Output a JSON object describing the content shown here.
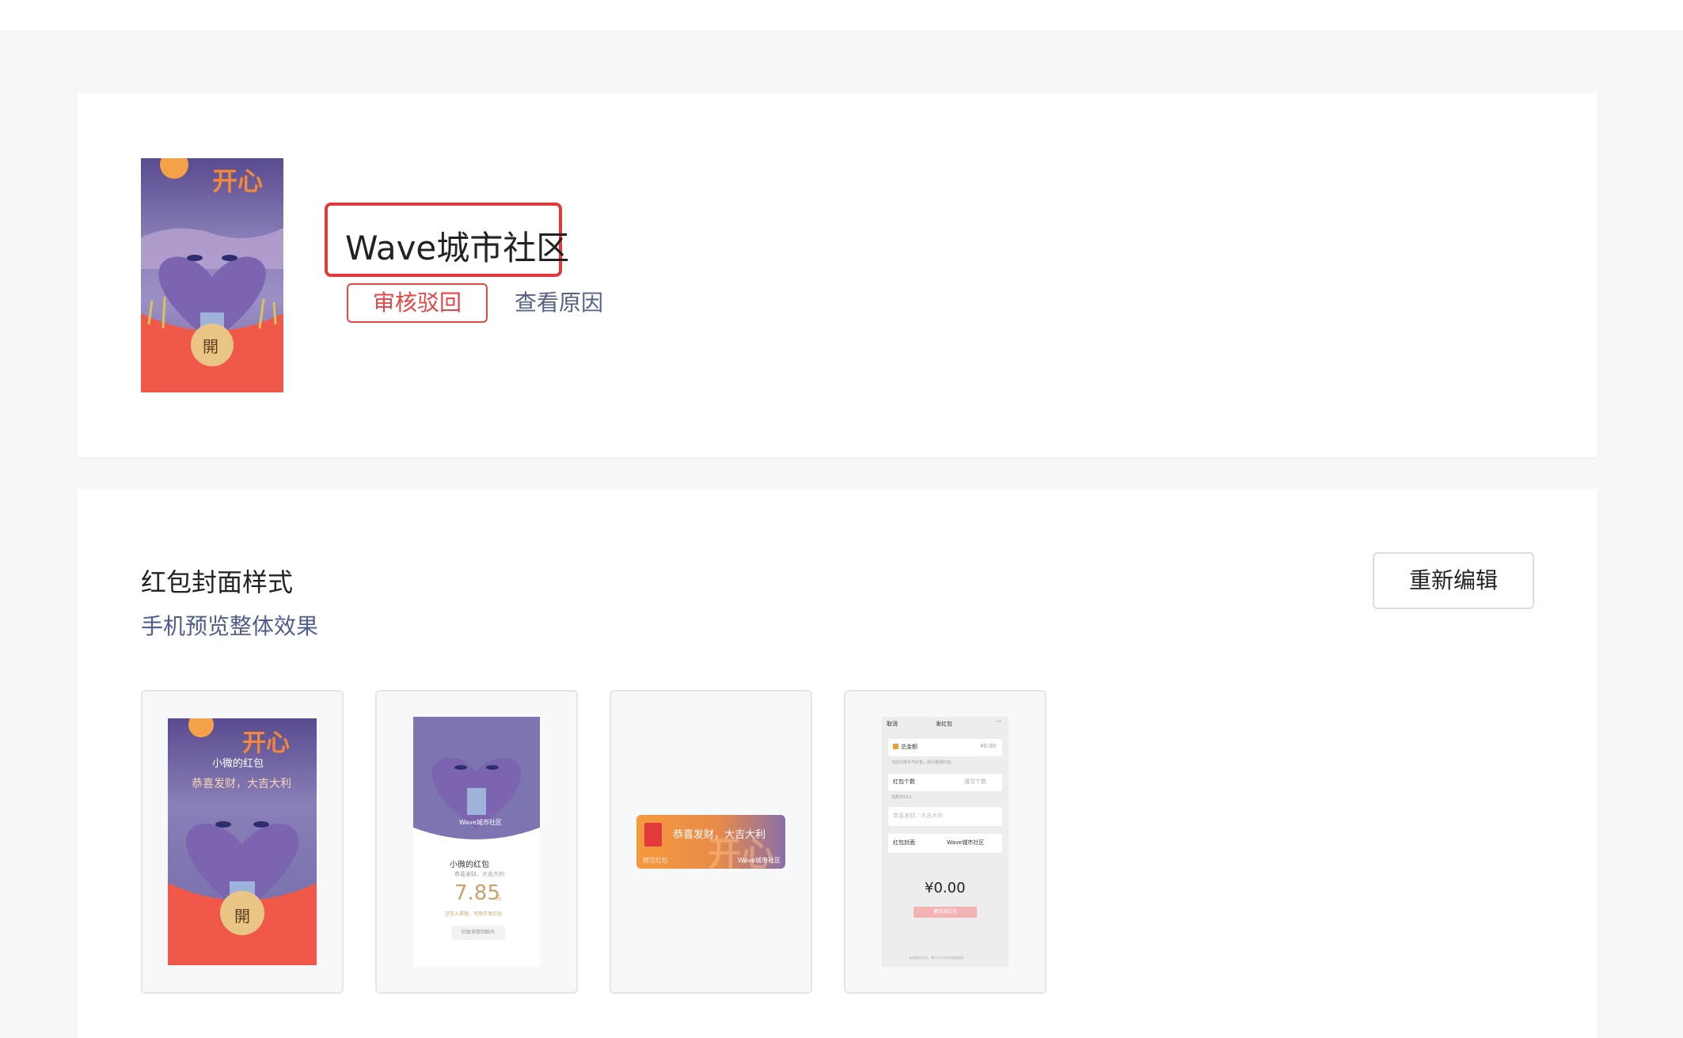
{
  "cover": {
    "art_title": "开心",
    "open_button": "開",
    "name": "Wave城市社区",
    "status": "审核驳回",
    "reason_link": "查看原因"
  },
  "section": {
    "title": "红包封面样式",
    "subtitle": "手机预览整体效果",
    "reedit_button": "重新编辑"
  },
  "previews": {
    "p1": {
      "sender": "小微的红包",
      "greeting": "恭喜发财，大吉大利",
      "art_title": "开心",
      "open_button": "開"
    },
    "p2": {
      "cover_name": "Wave城市社区",
      "sender": "小微的红包",
      "greeting": "恭喜发财，大吉大利",
      "amount": "7.85",
      "unit": "元",
      "note": "已存入零钱，可用于发红包",
      "reply": "回复表情到聊天"
    },
    "p3": {
      "greeting": "恭喜发财，大吉大利",
      "left_label": "微信红包",
      "cover_name": "Wave城市社区",
      "art_title": "开心"
    },
    "p4": {
      "cancel": "取消",
      "title": "发红包",
      "more": "···",
      "total_label": "总金额",
      "total_value": "¥0.00",
      "tip": "当前为拼手气红包，改为普通红包。",
      "count_label": "红包个数",
      "count_placeholder": "填写个数",
      "group_size": "本群共53人",
      "greeting_placeholder": "恭喜发财，大吉大利",
      "cover_label": "红包封面",
      "cover_value": "Wave城市社区",
      "amount": "¥0.00",
      "submit": "塞钱进红包",
      "footer": "未领取的红包，将于24小时后发起退款"
    }
  },
  "colors": {
    "accent_red": "#e23a3a",
    "link_blue": "#4e5d8c",
    "envelope_red": "#f0584a",
    "art_orange": "#f2883a",
    "coin_gold": "#e8c584"
  }
}
